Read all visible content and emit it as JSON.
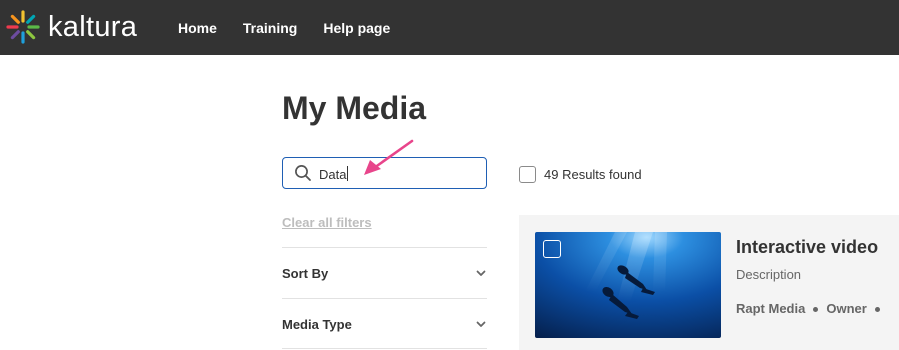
{
  "brand": {
    "name": "kaltura"
  },
  "nav": {
    "items": [
      "Home",
      "Training",
      "Help page"
    ]
  },
  "page": {
    "title": "My Media"
  },
  "search": {
    "value": "Data",
    "placeholder": ""
  },
  "results": {
    "text": "49 Results found"
  },
  "filters": {
    "clear_label": "Clear all filters",
    "sections": [
      {
        "label": "Sort By"
      },
      {
        "label": "Media Type"
      }
    ]
  },
  "media": [
    {
      "title": "Interactive video",
      "description": "Description",
      "author": "Rapt Media",
      "role": "Owner"
    }
  ],
  "colors": {
    "topbar": "#333333",
    "search_border": "#1f5fb4",
    "annotation_arrow": "#e8458b",
    "card_bg": "#f4f4f4"
  },
  "icons": {
    "logo": "kaltura-burst-icon",
    "search": "search-icon",
    "chevron": "chevron-down-icon",
    "annotation": "arrow-icon"
  }
}
